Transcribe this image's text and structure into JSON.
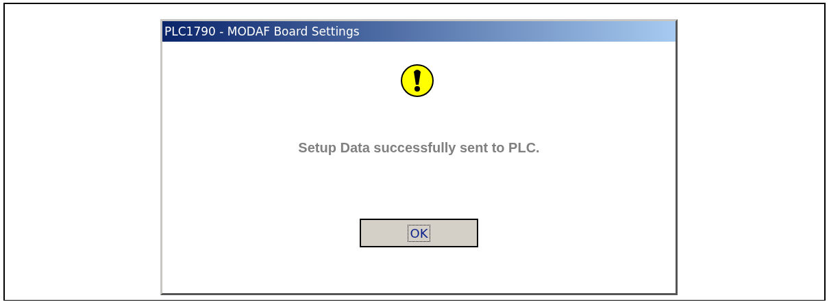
{
  "dialog": {
    "title": "PLC1790 - MODAF Board Settings",
    "message": "Setup Data successfully sent to PLC.",
    "buttons": [
      {
        "label": "OK",
        "focused": true
      }
    ]
  }
}
